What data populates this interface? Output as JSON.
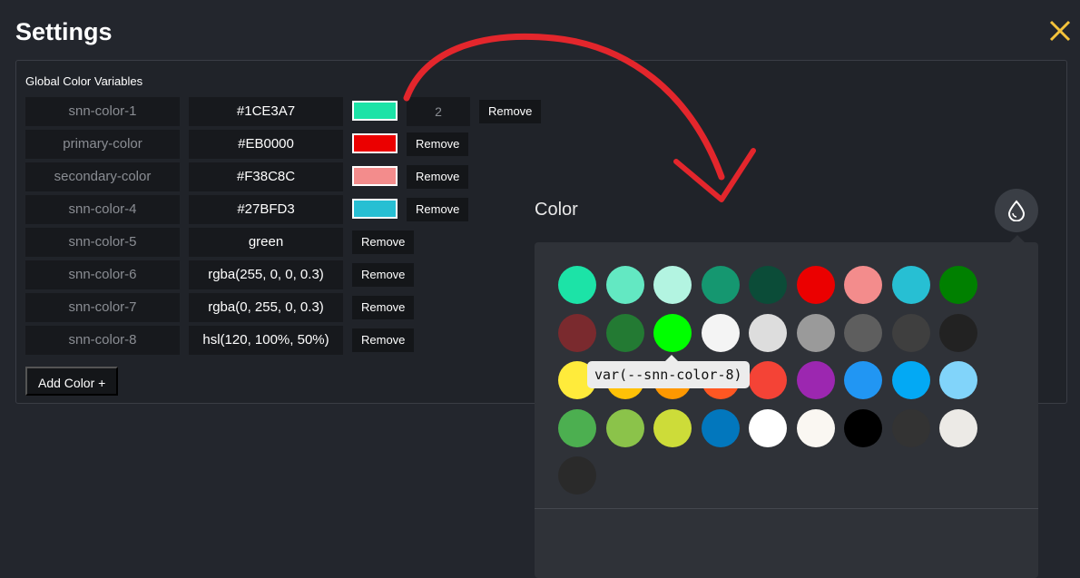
{
  "header": {
    "title": "Settings"
  },
  "panel": {
    "label": "Global Color Variables",
    "add_label": "Add Color +",
    "remove_label": "Remove",
    "rows": [
      {
        "name": "snn-color-1",
        "value": "#1CE3A7",
        "swatch": "#1CE3A7",
        "count": "2"
      },
      {
        "name": "primary-color",
        "value": "#EB0000",
        "swatch": "#EB0000"
      },
      {
        "name": "secondary-color",
        "value": "#F38C8C",
        "swatch": "#F38C8C"
      },
      {
        "name": "snn-color-4",
        "value": "#27BFD3",
        "swatch": "#27BFD3"
      },
      {
        "name": "snn-color-5",
        "value": "green"
      },
      {
        "name": "snn-color-6",
        "value": "rgba(255, 0, 0, 0.3)"
      },
      {
        "name": "snn-color-7",
        "value": "rgba(0, 255, 0, 0.3)"
      },
      {
        "name": "snn-color-8",
        "value": "hsl(120, 100%, 50%)"
      }
    ]
  },
  "picker": {
    "label": "Color",
    "tooltip": "var(--snn-color-8)",
    "swatches": [
      [
        "#1CE3A7",
        "#63E8C2",
        "#B3F4E1",
        "#159770",
        "#0B4C38",
        "#EB0000",
        "#F38C8C",
        "#27BFD3",
        "#008000"
      ],
      [
        "#7A2A2E",
        "#237A33",
        "#00FF00",
        "#F4F4F4",
        "#DDDDDD",
        "#9A9A9A",
        "#5E5E5E",
        "#3F3F3F",
        "#222222"
      ],
      [
        "#FFEB3B",
        "#FFC107",
        "#FF9800",
        "#FF5722",
        "#F44336",
        "#9C27B0",
        "#2196F3",
        "#03A9F4",
        "#81D4FA"
      ],
      [
        "#4CAF50",
        "#8BC34A",
        "#CDDC39",
        "#0277BD",
        "#FFFFFF",
        "#FAF7F2",
        "#000000",
        "#333333",
        "#ECEAE6"
      ],
      [
        "#2A2A2A"
      ]
    ]
  },
  "colors": {
    "close_icon": "#F5C33B",
    "arrow": "#E3262C"
  }
}
